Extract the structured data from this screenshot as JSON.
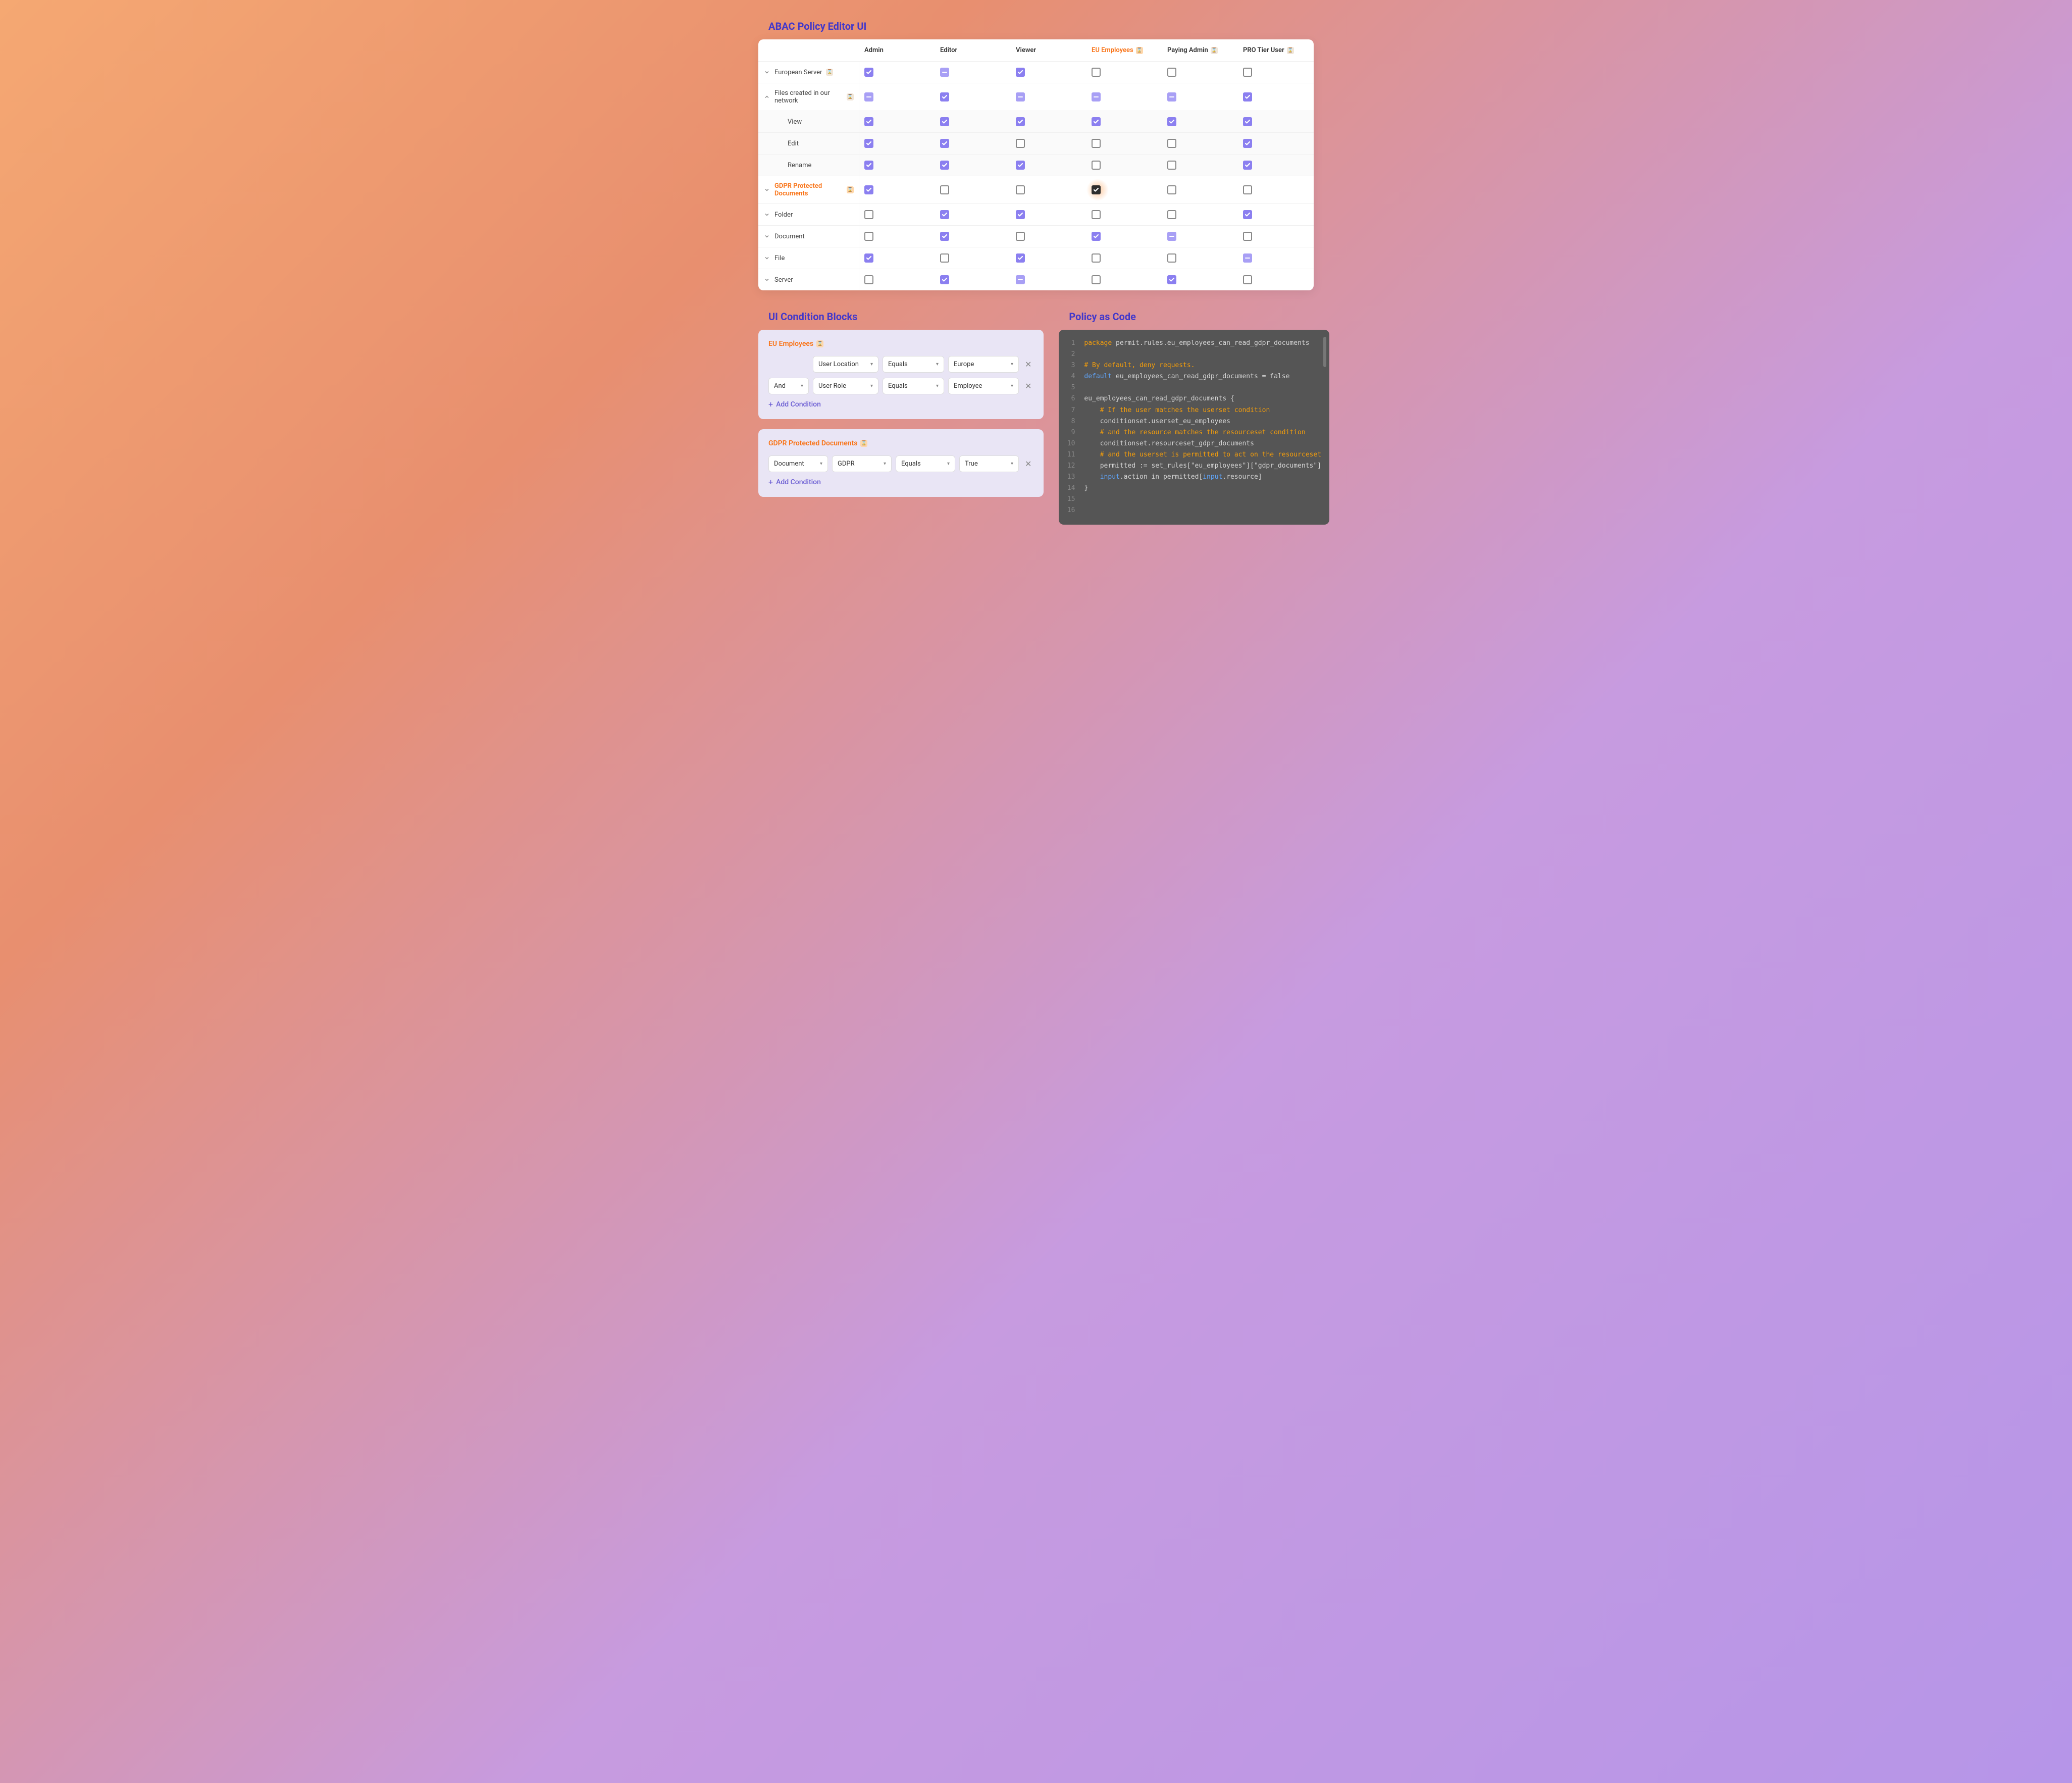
{
  "titles": {
    "policy_editor": "ABAC Policy Editor UI",
    "condition_blocks": "UI Condition Blocks",
    "policy_as_code": "Policy as Code"
  },
  "table": {
    "columns": [
      {
        "label": "Admin",
        "highlight": false,
        "badge": false
      },
      {
        "label": "Editor",
        "highlight": false,
        "badge": false
      },
      {
        "label": "Viewer",
        "highlight": false,
        "badge": false
      },
      {
        "label": "EU Employees",
        "highlight": true,
        "badge": true
      },
      {
        "label": "Paying Admin",
        "highlight": false,
        "badge": true
      },
      {
        "label": "PRO Tier User",
        "highlight": false,
        "badge": true
      }
    ],
    "rows": [
      {
        "label": "European Server",
        "expand": "down",
        "badge": true,
        "highlight": false,
        "sub": false,
        "cells": [
          "checked",
          "partial",
          "checked",
          "empty",
          "empty",
          "empty"
        ]
      },
      {
        "label": "Files created in our network",
        "expand": "up",
        "badge": true,
        "highlight": false,
        "sub": false,
        "cells": [
          "partial",
          "checked",
          "partial",
          "partial",
          "partial",
          "checked"
        ]
      },
      {
        "label": "View",
        "expand": "none",
        "badge": false,
        "highlight": false,
        "sub": true,
        "cells": [
          "checked",
          "checked",
          "checked",
          "checked",
          "checked",
          "checked"
        ]
      },
      {
        "label": "Edit",
        "expand": "none",
        "badge": false,
        "highlight": false,
        "sub": true,
        "cells": [
          "checked",
          "checked",
          "empty",
          "empty",
          "empty",
          "checked"
        ]
      },
      {
        "label": "Rename",
        "expand": "none",
        "badge": false,
        "highlight": false,
        "sub": true,
        "cells": [
          "checked",
          "checked",
          "checked",
          "empty",
          "empty",
          "checked"
        ]
      },
      {
        "label": "GDPR Protected Documents",
        "expand": "down",
        "badge": true,
        "highlight": true,
        "sub": false,
        "glow_col": 3,
        "cells": [
          "checked",
          "empty",
          "empty",
          "checked-dark",
          "empty",
          "empty"
        ]
      },
      {
        "label": "Folder",
        "expand": "down",
        "badge": false,
        "highlight": false,
        "sub": false,
        "cells": [
          "empty",
          "checked",
          "checked",
          "empty",
          "empty",
          "checked"
        ]
      },
      {
        "label": "Document",
        "expand": "down",
        "badge": false,
        "highlight": false,
        "sub": false,
        "cells": [
          "empty",
          "checked",
          "empty",
          "checked",
          "partial",
          "empty"
        ]
      },
      {
        "label": "File",
        "expand": "down",
        "badge": false,
        "highlight": false,
        "sub": false,
        "cells": [
          "checked",
          "empty",
          "checked",
          "empty",
          "empty",
          "partial"
        ]
      },
      {
        "label": "Server",
        "expand": "down",
        "badge": false,
        "highlight": false,
        "sub": false,
        "cells": [
          "empty",
          "checked",
          "partial",
          "empty",
          "checked",
          "empty"
        ]
      }
    ]
  },
  "condition_blocks": [
    {
      "title": "EU Employees",
      "rows": [
        {
          "offset": true,
          "fields": [
            {
              "type": "select",
              "value": "User Location",
              "w": "w-130"
            },
            {
              "type": "select",
              "value": "Equals",
              "w": "w-120"
            },
            {
              "type": "select",
              "value": "Europe",
              "w": "w-140"
            }
          ],
          "close": true
        },
        {
          "offset": false,
          "fields": [
            {
              "type": "select",
              "value": "And",
              "w": "w-80"
            },
            {
              "type": "select",
              "value": "User Role",
              "w": "w-130"
            },
            {
              "type": "select",
              "value": "Equals",
              "w": "w-120"
            },
            {
              "type": "select",
              "value": "Employee",
              "w": "w-140"
            }
          ],
          "close": true
        }
      ],
      "add_label": "Add Condition"
    },
    {
      "title": "GDPR Protected Documents",
      "rows": [
        {
          "offset": false,
          "fields": [
            {
              "type": "select",
              "value": "Document",
              "w": "flex-1"
            },
            {
              "type": "select",
              "value": "GDPR",
              "w": "flex-1"
            },
            {
              "type": "select",
              "value": "Equals",
              "w": "flex-1"
            },
            {
              "type": "select",
              "value": "True",
              "w": "flex-1"
            }
          ],
          "close": true
        }
      ],
      "add_label": "Add Condition"
    }
  ],
  "code": {
    "lines": [
      {
        "n": 1,
        "tokens": [
          [
            "keyword",
            "package"
          ],
          [
            "ident",
            " permit.rules.eu_employees_can_read_gdpr_documents"
          ]
        ]
      },
      {
        "n": 2,
        "tokens": []
      },
      {
        "n": 3,
        "tokens": [
          [
            "comment",
            "# By default, deny requests."
          ]
        ]
      },
      {
        "n": 4,
        "tokens": [
          [
            "default",
            "default"
          ],
          [
            "ident",
            " eu_employees_can_read_gdpr_documents = false"
          ]
        ]
      },
      {
        "n": 5,
        "tokens": []
      },
      {
        "n": 6,
        "tokens": [
          [
            "ident",
            "eu_employees_can_read_gdpr_documents {"
          ]
        ]
      },
      {
        "n": 7,
        "tokens": [
          [
            "ident",
            "    "
          ],
          [
            "comment",
            "# If the user matches the userset condition"
          ]
        ]
      },
      {
        "n": 8,
        "tokens": [
          [
            "ident",
            "    conditionset.userset_eu_employees"
          ]
        ]
      },
      {
        "n": 9,
        "tokens": [
          [
            "ident",
            "    "
          ],
          [
            "comment",
            "# and the resource matches the resourceset condition"
          ]
        ]
      },
      {
        "n": 10,
        "tokens": [
          [
            "ident",
            "    conditionset.resourceset_gdpr_documents"
          ]
        ]
      },
      {
        "n": 11,
        "tokens": [
          [
            "ident",
            "    "
          ],
          [
            "comment",
            "# and the userset is permitted to act on the resourceset"
          ]
        ]
      },
      {
        "n": 12,
        "tokens": [
          [
            "ident",
            "    permitted := set_rules[\"eu_employees\"][\"gdpr_documents\"]"
          ]
        ]
      },
      {
        "n": 13,
        "tokens": [
          [
            "ident",
            "    "
          ],
          [
            "input",
            "input"
          ],
          [
            "ident",
            ".action in permitted["
          ],
          [
            "input",
            "input"
          ],
          [
            "ident",
            ".resource]"
          ]
        ]
      },
      {
        "n": 14,
        "tokens": [
          [
            "ident",
            "}"
          ]
        ]
      },
      {
        "n": 15,
        "tokens": []
      },
      {
        "n": 16,
        "tokens": []
      }
    ]
  }
}
